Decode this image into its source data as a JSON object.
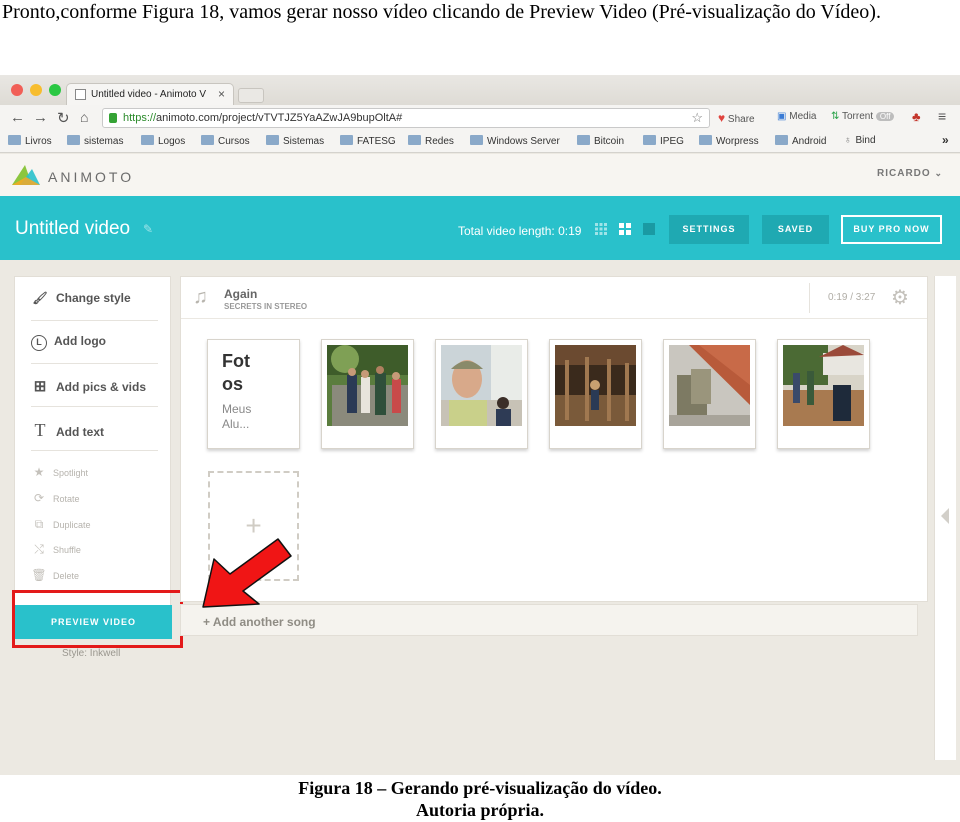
{
  "document": {
    "intro": "Pronto,conforme Figura 18, vamos gerar nosso vídeo clicando de Preview Video (Pré-visualização do Vídeo).",
    "caption_line1": "Figura 18 – Gerando pré-visualização do vídeo.",
    "caption_line2": "Autoria própria."
  },
  "browser": {
    "tab_title": "Untitled video - Animoto V",
    "tab_close": "×",
    "url_protocol": "https://",
    "url_rest": "animoto.com/project/vTVTJZ5YaAZwJA9bupOltA#",
    "extensions": [
      "Share",
      "Media",
      "Torrent",
      "Off"
    ],
    "bookmarks": [
      "Livros",
      "sistemas",
      "Logos",
      "Cursos",
      "Sistemas",
      "FATESG",
      "Redes",
      "Windows Server",
      "Bitcoin",
      "IPEG",
      "Worpress",
      "Android",
      "Bind"
    ],
    "bookmarks_more": "»"
  },
  "app": {
    "logo_text": "ANIMOTO",
    "user": "RICARDO",
    "video_title": "Untitled video",
    "video_length": "Total video length: 0:19",
    "buttons": {
      "settings": "SETTINGS",
      "saved": "SAVED",
      "buy": "BUY PRO NOW"
    },
    "sidebar": {
      "primary": [
        {
          "icon": "paintbrush-icon",
          "label": "Change style"
        },
        {
          "icon": "logo-icon",
          "label": "Add logo"
        },
        {
          "icon": "add-pics-icon",
          "label": "Add pics & vids"
        },
        {
          "icon": "text-icon",
          "label": "Add text"
        }
      ],
      "secondary": [
        "Spotlight",
        "Rotate",
        "Duplicate",
        "Shuffle",
        "Delete"
      ]
    },
    "preview_button": "PREVIEW VIDEO",
    "style_label": "Style: Inkwell",
    "song": {
      "title": "Again",
      "artist": "SECRETS IN STEREO",
      "time": "0:19 / 3:27"
    },
    "text_card": {
      "title": "Fot os",
      "subtitle": "Meus Alu..."
    },
    "add_slot": "+",
    "add_song": "+ Add another song"
  }
}
